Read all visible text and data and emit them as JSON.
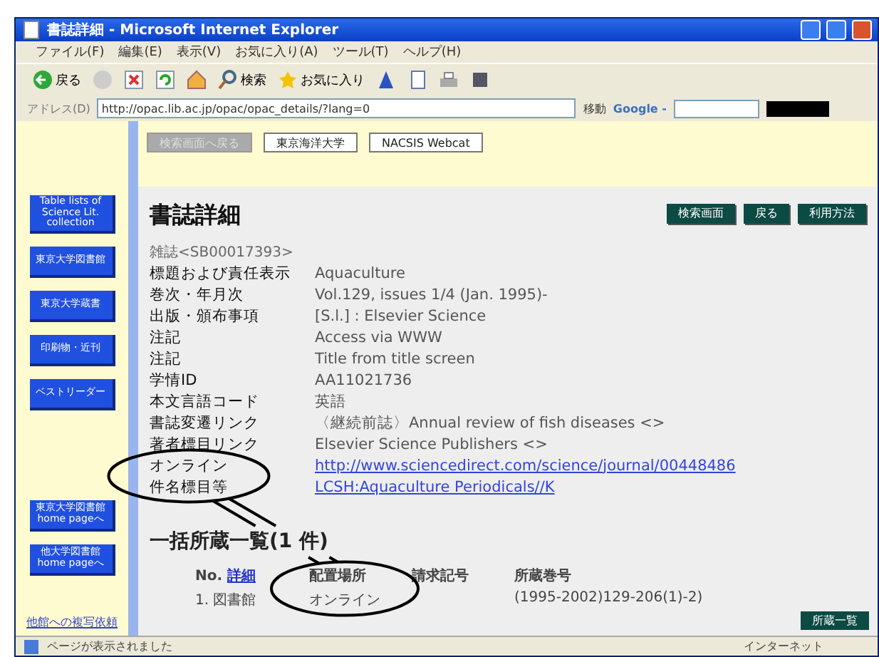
{
  "window": {
    "title": "書誌詳細 - Microsoft Internet Explorer"
  },
  "menu": [
    "ファイル(F)",
    "編集(E)",
    "表示(V)",
    "お気に入り(A)",
    "ツール(T)",
    "ヘルプ(H)"
  ],
  "toolbar": {
    "back": "戻る",
    "search": "検索",
    "favorites": "お気に入り"
  },
  "address": {
    "label": "アドレス(D)",
    "url": "http://opac.lib.ac.jp/opac/opac_details/?lang=0",
    "go": "移動",
    "search_brand": "Google -"
  },
  "sidebar": {
    "buttons": [
      "Table lists of Science Lit. collection",
      "東京大学図書館",
      "東京大学蔵書",
      "印刷物・近刊",
      "ベストリーダー",
      "東京大学図書館 home pageへ",
      "他大学図書館 home pageへ"
    ],
    "link": "他館への複写依頼"
  },
  "top_buttons": [
    {
      "label": "検索画面へ戻る",
      "disabled": true
    },
    {
      "label": "東京海洋大学",
      "disabled": false
    },
    {
      "label": "NACSIS Webcat",
      "disabled": false
    }
  ],
  "page_title": "書誌詳細",
  "action_buttons": [
    "検索画面",
    "戻る",
    "利用方法"
  ],
  "record": {
    "id_line": "雑誌<SB00017393>",
    "fields": [
      {
        "label": "標題および責任表示",
        "value": "Aquaculture",
        "kind": "text"
      },
      {
        "label": "巻次・年月次",
        "value": "Vol.129, issues 1/4 (Jan. 1995)-",
        "kind": "text"
      },
      {
        "label": "出版・頒布事項",
        "value": "[S.l.] : Elsevier Science",
        "kind": "text"
      },
      {
        "label": "注記",
        "value": "Access via WWW",
        "kind": "text"
      },
      {
        "label": "注記",
        "value": "Title from title screen",
        "kind": "text"
      },
      {
        "label": "学情ID",
        "value": "AA11021736",
        "kind": "text"
      },
      {
        "label": "本文言語コード",
        "value": "英語",
        "kind": "text"
      },
      {
        "label": "書誌変遷リンク",
        "value": "〈継続前誌〉Annual review of fish diseases <>",
        "kind": "text"
      },
      {
        "label": "著者標目リンク",
        "value": "Elsevier Science Publishers <>",
        "kind": "text"
      },
      {
        "label": "オンライン",
        "value": "http://www.sciencedirect.com/science/journal/00448486",
        "kind": "link"
      },
      {
        "label": "件名標目等",
        "value": "LCSH:Aquaculture Periodicals//K",
        "kind": "link"
      }
    ]
  },
  "holdings": {
    "title": "一括所蔵一覧(1 件)",
    "no_label": "No.",
    "detail_link": "詳細",
    "columns": [
      "配置場所",
      "請求記号",
      "所蔵巻号"
    ],
    "rows": [
      {
        "no": "1.",
        "library": "図書館",
        "place": "オンライン",
        "call": "",
        "volumes": "(1995-2002)129-206(1)-2)"
      }
    ]
  },
  "list_button": "所蔵一覧",
  "status_bar": {
    "text": "ページが表示されました",
    "zone": "インターネット"
  }
}
